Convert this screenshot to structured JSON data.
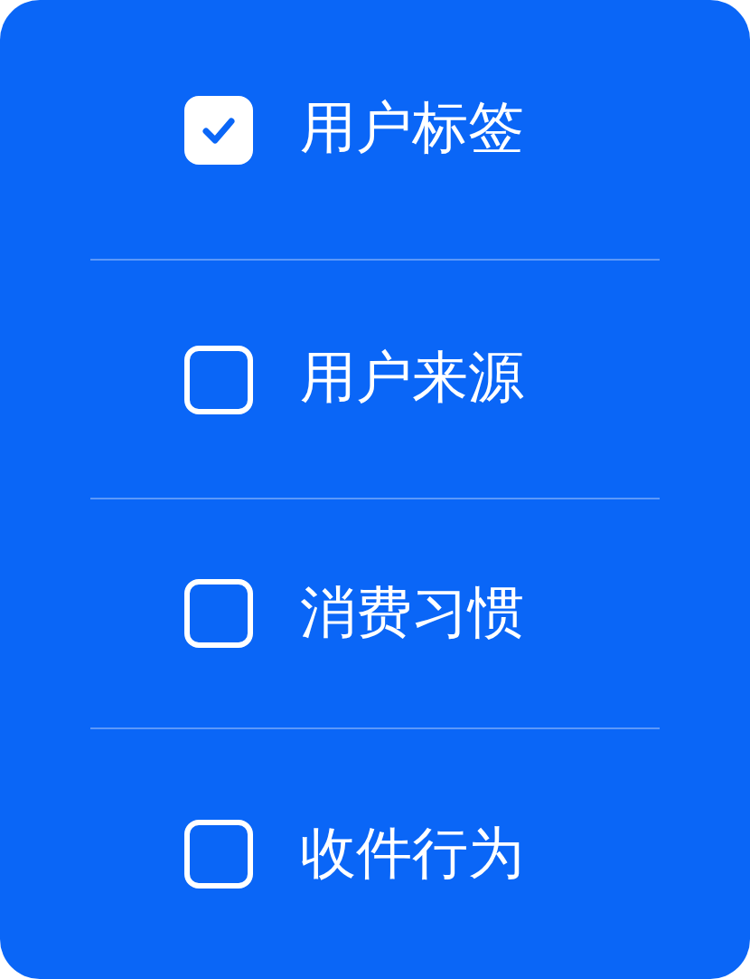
{
  "options": [
    {
      "label": "用户标签",
      "checked": true
    },
    {
      "label": "用户来源",
      "checked": false
    },
    {
      "label": "消费习惯",
      "checked": false
    },
    {
      "label": "收件行为",
      "checked": false
    }
  ]
}
